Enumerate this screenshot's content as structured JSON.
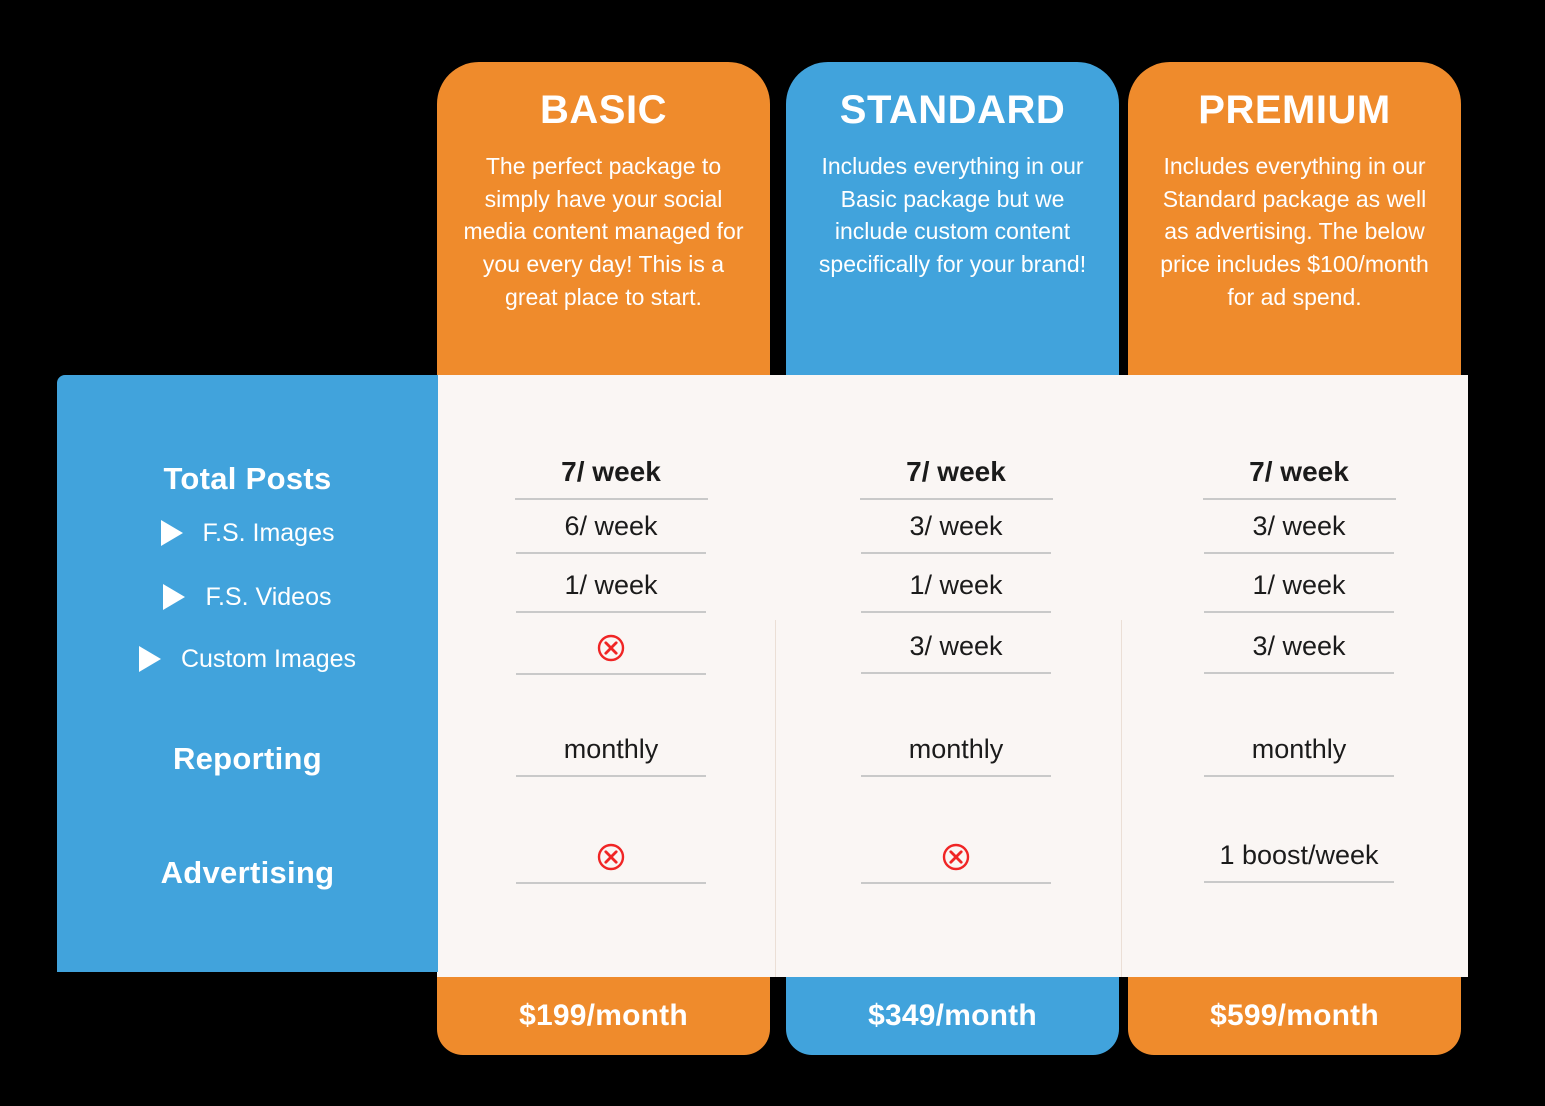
{
  "colors": {
    "orange": "#EF8B2C",
    "blue": "#41A3DC",
    "cream": "#FAF6F4",
    "rule": "#c9c9c9",
    "cross_red": "#F02525",
    "page_bg": "#000000"
  },
  "sidebar": {
    "rows": [
      {
        "label": "Total Posts",
        "type": "header",
        "icon": null
      },
      {
        "label": "F.S. Images",
        "type": "sub",
        "icon": "triangle-right-icon"
      },
      {
        "label": "F.S. Videos",
        "type": "sub",
        "icon": "triangle-right-icon"
      },
      {
        "label": "Custom Images",
        "type": "sub",
        "icon": "triangle-right-icon"
      },
      {
        "label": "Reporting",
        "type": "header",
        "icon": null
      },
      {
        "label": "Advertising",
        "type": "header",
        "icon": null
      }
    ]
  },
  "plans": [
    {
      "key": "basic",
      "name": "BASIC",
      "accent": "#EF8B2C",
      "description": "The perfect package to simply have your social media content managed for you every day! This is a great place to start.",
      "price": "$199/month",
      "values": [
        {
          "text": "7/ week",
          "kind": "text",
          "bold": true
        },
        {
          "text": "6/ week",
          "kind": "text",
          "bold": false
        },
        {
          "text": "1/ week",
          "kind": "text",
          "bold": false
        },
        {
          "text": "",
          "kind": "cross",
          "bold": false,
          "icon": "circle-x-icon"
        },
        {
          "text": "monthly",
          "kind": "text",
          "bold": false
        },
        {
          "text": "",
          "kind": "cross",
          "bold": false,
          "icon": "circle-x-icon"
        }
      ]
    },
    {
      "key": "standard",
      "name": "STANDARD",
      "accent": "#41A3DC",
      "description": "Includes everything in our Basic package but we include custom content specifically for your brand!",
      "price": "$349/month",
      "values": [
        {
          "text": "7/ week",
          "kind": "text",
          "bold": true
        },
        {
          "text": "3/ week",
          "kind": "text",
          "bold": false
        },
        {
          "text": "1/ week",
          "kind": "text",
          "bold": false
        },
        {
          "text": "3/ week",
          "kind": "text",
          "bold": false
        },
        {
          "text": "monthly",
          "kind": "text",
          "bold": false
        },
        {
          "text": "",
          "kind": "cross",
          "bold": false,
          "icon": "circle-x-icon"
        }
      ]
    },
    {
      "key": "premium",
      "name": "PREMIUM",
      "accent": "#EF8B2C",
      "description": "Includes everything in our Standard package as well as advertising. The below price includes $100/month for ad spend.",
      "price": "$599/month",
      "values": [
        {
          "text": "7/ week",
          "kind": "text",
          "bold": true
        },
        {
          "text": "3/ week",
          "kind": "text",
          "bold": false
        },
        {
          "text": "1/ week",
          "kind": "text",
          "bold": false
        },
        {
          "text": "3/ week",
          "kind": "text",
          "bold": false
        },
        {
          "text": "monthly",
          "kind": "text",
          "bold": false
        },
        {
          "text": "1 boost/week",
          "kind": "text",
          "bold": false
        }
      ]
    }
  ]
}
